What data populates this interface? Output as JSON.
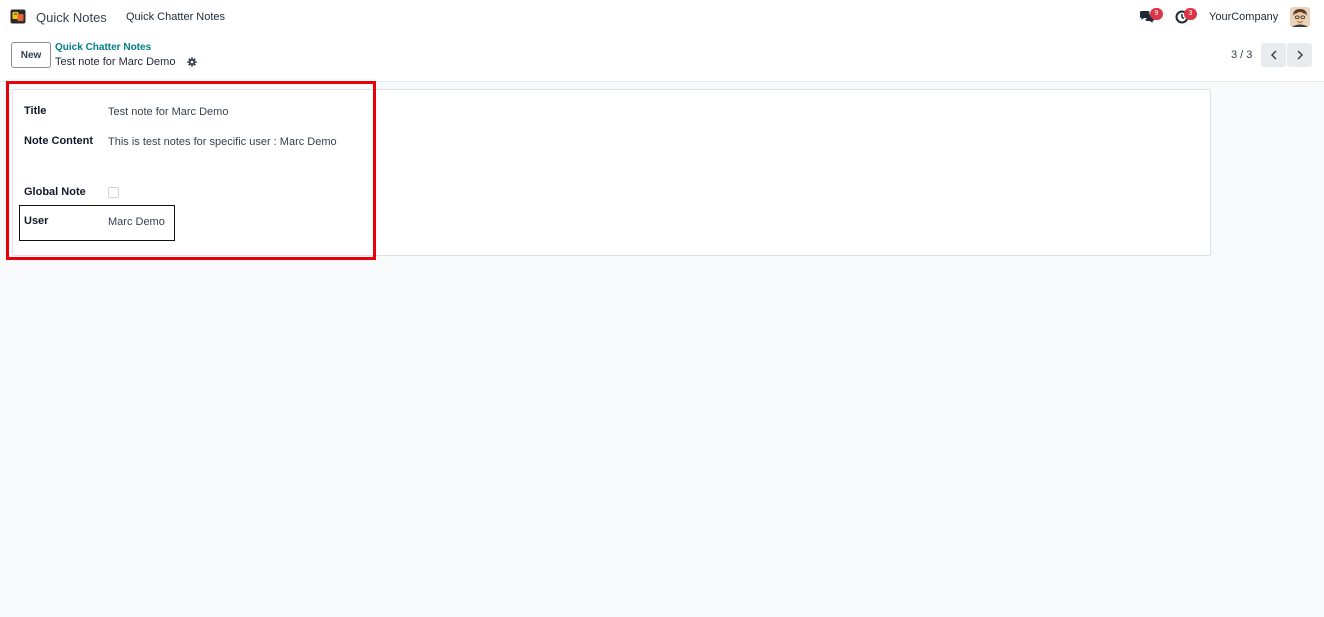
{
  "navbar": {
    "app_icon": "quick-notes-app-icon",
    "app_name": "Quick Notes",
    "menu_item": "Quick Chatter Notes",
    "messages_icon": "chat-bubbles-icon",
    "messages_count": "9",
    "activities_icon": "clock-icon",
    "activities_count": "3",
    "company": "YourCompany",
    "avatar_icon": "user-avatar"
  },
  "control_panel": {
    "new_button": "New",
    "breadcrumb_parent": "Quick Chatter Notes",
    "breadcrumb_current": "Test note for Marc Demo",
    "actions_icon": "gear-icon",
    "pager_value": "3 / 3",
    "prev_icon": "chevron-left-icon",
    "next_icon": "chevron-right-icon"
  },
  "form": {
    "title_label": "Title",
    "title_value": "Test note for Marc Demo",
    "note_content_label": "Note Content",
    "note_content_value": "This is test notes for specific user : Marc Demo",
    "global_note_label": "Global Note",
    "global_note_checked": false,
    "user_label": "User",
    "user_value": "Marc Demo"
  },
  "colors": {
    "primary_link": "#017e84",
    "badge": "#dc3545",
    "annotation_red": "#e8000b",
    "background": "#f9fafb"
  }
}
